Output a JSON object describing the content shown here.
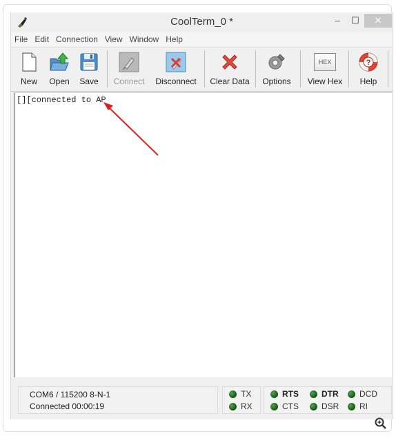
{
  "window": {
    "title": "CoolTerm_0 *",
    "controls": {
      "minimize": "–",
      "maximize": "☐",
      "close": "✕"
    }
  },
  "menu": [
    "File",
    "Edit",
    "Connection",
    "View",
    "Window",
    "Help"
  ],
  "toolbar": {
    "new": "New",
    "open": "Open",
    "save": "Save",
    "connect": "Connect",
    "disconnect": "Disconnect",
    "clear_data": "Clear Data",
    "options": "Options",
    "view_hex": "View Hex",
    "hex_badge": "HEX",
    "help": "Help"
  },
  "terminal": {
    "lines": [
      "[][connected to AP"
    ]
  },
  "status": {
    "port": "COM6 / 115200 8-N-1",
    "connection": "Connected 00:00:19",
    "leds": {
      "tx": "TX",
      "rx": "RX",
      "rts": "RTS",
      "cts": "CTS",
      "dtr": "DTR",
      "dsr": "DSR",
      "dcd": "DCD",
      "ri": "RI"
    },
    "led_color": "#1f6b1f"
  },
  "annotation": {
    "arrow_color": "#e02020"
  }
}
